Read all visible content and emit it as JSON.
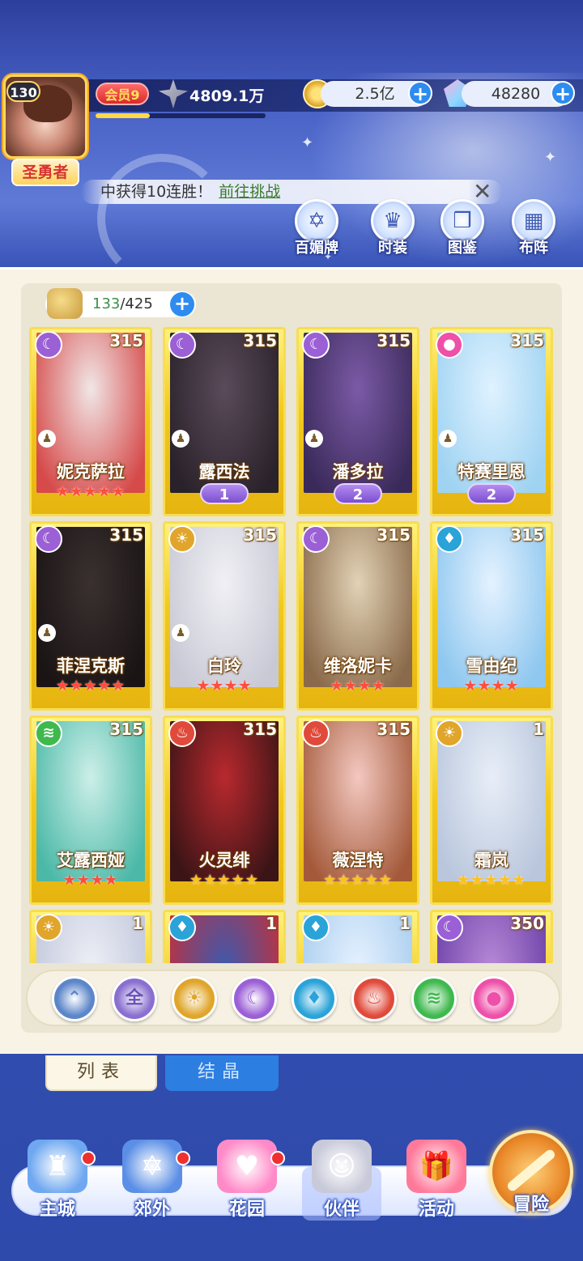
{
  "player": {
    "level": "130",
    "title": "圣勇者",
    "vip": "会员9",
    "power": "4809.1万",
    "exp_progress": 0.32
  },
  "resources": {
    "gold": "2.5亿",
    "gems": "48280"
  },
  "notice": {
    "text": "中获得10连胜！",
    "link": "前往挑战"
  },
  "quick_menu": [
    {
      "label": "百媚牌",
      "icon": "hexagram-icon"
    },
    {
      "label": "时装",
      "icon": "dress-icon"
    },
    {
      "label": "图鉴",
      "icon": "book-icon"
    },
    {
      "label": "布阵",
      "icon": "formation-grid-icon"
    }
  ],
  "collection": {
    "count": "133",
    "total": "/425"
  },
  "cards": [
    {
      "name": "妮克萨拉",
      "level": "315",
      "element": "moon",
      "stars": "★★★★★",
      "rank": "",
      "gold": false,
      "pawn": true
    },
    {
      "name": "露西法",
      "level": "315",
      "element": "moon",
      "stars": "",
      "rank": "1",
      "gold": false,
      "pawn": true
    },
    {
      "name": "潘多拉",
      "level": "315",
      "element": "moon",
      "stars": "",
      "rank": "2",
      "gold": false,
      "pawn": true
    },
    {
      "name": "特赛里恩",
      "level": "315",
      "element": "spirit",
      "stars": "",
      "rank": "2",
      "gold": false,
      "pawn": true
    },
    {
      "name": "菲涅克斯",
      "level": "315",
      "element": "moon",
      "stars": "★★★★★",
      "rank": "",
      "gold": false,
      "pawn": true
    },
    {
      "name": "白玲",
      "level": "315",
      "element": "sun",
      "stars": "★★★★",
      "rank": "",
      "gold": false,
      "pawn": true
    },
    {
      "name": "维洛妮卡",
      "level": "315",
      "element": "moon",
      "stars": "★★★★",
      "rank": "",
      "gold": false,
      "pawn": false
    },
    {
      "name": "雪由纪",
      "level": "315",
      "element": "water",
      "stars": "★★★★",
      "rank": "",
      "gold": false,
      "pawn": false
    },
    {
      "name": "艾露西娅",
      "level": "315",
      "element": "wind",
      "stars": "★★★★",
      "rank": "",
      "gold": false,
      "pawn": false
    },
    {
      "name": "火灵绯",
      "level": "315",
      "element": "fire",
      "stars": "★★★★★",
      "rank": "",
      "gold": true,
      "pawn": false
    },
    {
      "name": "薇涅特",
      "level": "315",
      "element": "fire",
      "stars": "★★★★★",
      "rank": "",
      "gold": true,
      "pawn": false
    },
    {
      "name": "霜岚",
      "level": "1",
      "element": "sun",
      "stars": "★★★★★",
      "rank": "",
      "gold": true,
      "pawn": false
    },
    {
      "name": "",
      "level": "1",
      "element": "sun",
      "stars": "",
      "rank": "",
      "gold": false,
      "pawn": false
    },
    {
      "name": "",
      "level": "1",
      "element": "water",
      "stars": "",
      "rank": "",
      "gold": false,
      "pawn": false
    },
    {
      "name": "",
      "level": "1",
      "element": "water",
      "stars": "",
      "rank": "",
      "gold": false,
      "pawn": false
    },
    {
      "name": "",
      "level": "350",
      "element": "moon",
      "stars": "",
      "rank": "",
      "gold": false,
      "pawn": false
    }
  ],
  "element_colors": {
    "moon": "#9b5fd6",
    "sun": "#e0a52a",
    "water": "#2aa3d8",
    "fire": "#e04a3a",
    "wind": "#3fb94e",
    "spirit": "#ee4fa8"
  },
  "filters": [
    {
      "label": "",
      "icon": "collapse-arrow-icon",
      "color": "#5c86c9"
    },
    {
      "label": "全",
      "icon": "all-icon",
      "color": "#8a6fd0"
    },
    {
      "label": "",
      "icon": "sun-icon",
      "color": "#e0a52a"
    },
    {
      "label": "",
      "icon": "moon-icon",
      "color": "#9b5fd6"
    },
    {
      "label": "",
      "icon": "water-drop-icon",
      "color": "#2aa3d8"
    },
    {
      "label": "",
      "icon": "fire-icon",
      "color": "#e04a3a"
    },
    {
      "label": "",
      "icon": "wind-icon",
      "color": "#3fb94e"
    },
    {
      "label": "",
      "icon": "spirit-icon",
      "color": "#ee4fa8"
    }
  ],
  "tabs": {
    "list": "列表",
    "crystal": "结晶"
  },
  "nav": [
    {
      "label": "主城",
      "icon": "castle-icon",
      "dot": true
    },
    {
      "label": "郊外",
      "icon": "hexagram-emblem-icon",
      "dot": true
    },
    {
      "label": "花园",
      "icon": "heart-icon",
      "dot": true
    },
    {
      "label": "伙伴",
      "icon": "companion-portrait-icon",
      "dot": false
    },
    {
      "label": "活动",
      "icon": "gift-box-icon",
      "dot": false
    }
  ],
  "adventure_label": "冒险"
}
